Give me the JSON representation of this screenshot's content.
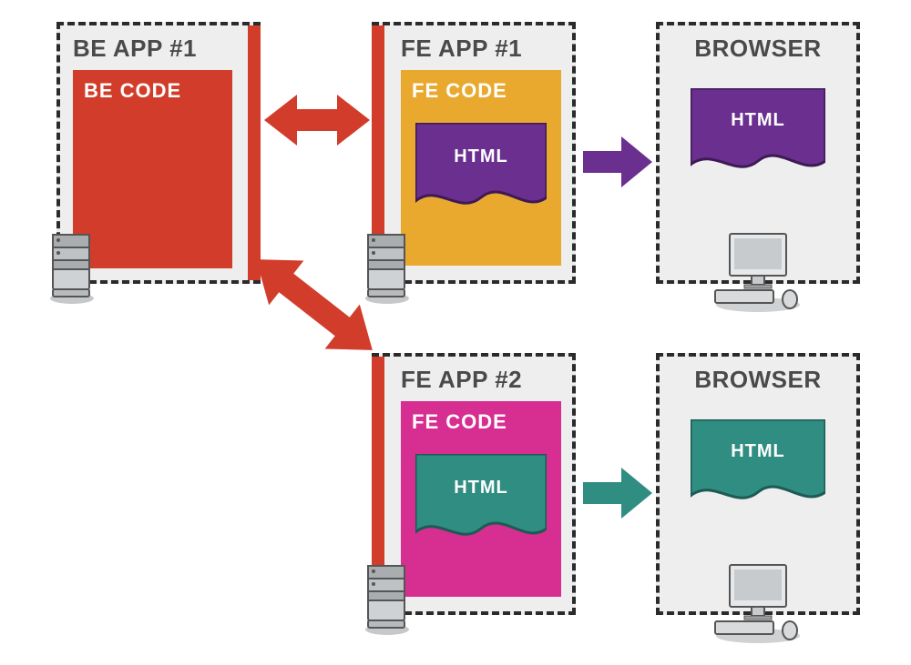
{
  "boxes": {
    "be_app": {
      "title": "BE APP #1",
      "code_label": "BE CODE"
    },
    "fe_app_1": {
      "title": "FE APP #1",
      "code_label": "FE CODE",
      "html_label": "HTML"
    },
    "fe_app_2": {
      "title": "FE APP #2",
      "code_label": "FE CODE",
      "html_label": "HTML"
    },
    "browser_1": {
      "title": "BROWSER",
      "html_label": "HTML"
    },
    "browser_2": {
      "title": "BROWSER",
      "html_label": "HTML"
    }
  },
  "colors": {
    "red": "#d23c2a",
    "orange": "#e9a92f",
    "purple": "#6b2f8f",
    "magenta": "#d62e91",
    "teal": "#2f8d82"
  }
}
